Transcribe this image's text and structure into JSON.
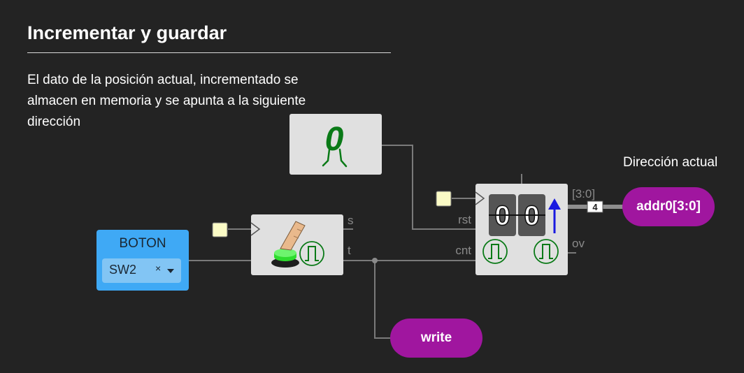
{
  "heading": {
    "title": "Incrementar y guardar",
    "description": "El dato de la posición actual, incrementado se almacen en memoria y se apunta a la siguiente dirección"
  },
  "labels": {
    "current_address": "Dirección actual"
  },
  "button_block": {
    "title": "BOTON",
    "selected": "SW2",
    "clear": "×"
  },
  "pulse_block": {
    "pins": {
      "s": "s",
      "t": "t"
    }
  },
  "constant_block": {
    "value": "0"
  },
  "counter_block": {
    "pins": {
      "rst": "rst",
      "cnt": "cnt",
      "range": "[3:0]",
      "ov": "ov"
    },
    "bus_width": "4"
  },
  "outputs": {
    "addr": "addr0[3:0]",
    "write": "write"
  },
  "colors": {
    "background": "#232323",
    "block": "#e0e0e0",
    "input_block": "#3fa9f5",
    "output_pill": "#a0169f",
    "constant_green": "#0a7a17",
    "up_arrow": "#1a1ae0",
    "trigger_input": "#fbfbc6"
  }
}
